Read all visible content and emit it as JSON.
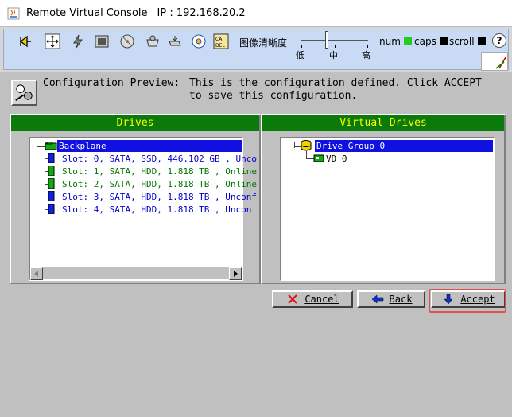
{
  "window": {
    "title": "Remote Virtual Console",
    "ip_label": "IP : 192.168.20.2"
  },
  "toolbar": {
    "clarity_label": "图像清晰度",
    "clarity_levels": [
      "低",
      "中",
      "高"
    ],
    "locks": [
      {
        "name": "num",
        "color": "#22cc22"
      },
      {
        "name": "caps",
        "color": "#000000"
      },
      {
        "name": "scroll",
        "color": "#000000"
      }
    ],
    "help_label": "?"
  },
  "config": {
    "label": "Configuration Preview:",
    "description": "This is the configuration defined. Click ACCEPT to save this configuration."
  },
  "drives_panel": {
    "header": "Drives",
    "root": "Backplane",
    "slots": [
      {
        "text": "Slot: 0, SATA, SSD, 446.102 GB , Unco",
        "color": "#0000cc"
      },
      {
        "text": "Slot: 1, SATA, HDD, 1.818 TB , Online",
        "color": "#007700"
      },
      {
        "text": "Slot: 2, SATA, HDD, 1.818 TB , Online",
        "color": "#007700"
      },
      {
        "text": "Slot: 3, SATA, HDD, 1.818 TB , Unconf",
        "color": "#0000cc"
      },
      {
        "text": "Slot: 4, SATA, HDD, 1.818 TB , Uncon",
        "color": "#0000cc"
      }
    ]
  },
  "virtual_panel": {
    "header": "Virtual Drives",
    "group": "Drive Group 0",
    "vd": "VD 0"
  },
  "buttons": {
    "cancel": "Cancel",
    "back": "Back",
    "accept": "Accept"
  },
  "colors": {
    "header_green": "#0a7a0a",
    "header_text": "#ffff00",
    "selection": "#1010e0",
    "highlight": "#e05050"
  }
}
